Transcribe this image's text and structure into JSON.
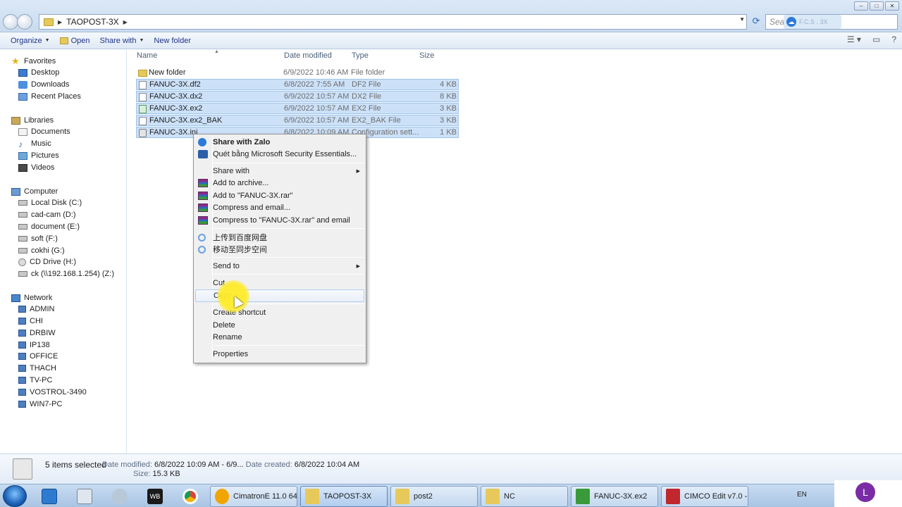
{
  "window": {
    "address": {
      "segments": [
        "TAOPOST-3X"
      ]
    },
    "search_placeholder": "Sea",
    "zalo_overlay": "F.C.S . 3X"
  },
  "toolbar": {
    "organize": "Organize",
    "open": "Open",
    "share_with": "Share with",
    "new_folder": "New folder"
  },
  "nav": {
    "favorites": "Favorites",
    "desktop": "Desktop",
    "downloads": "Downloads",
    "recent_places": "Recent Places",
    "libraries": "Libraries",
    "documents": "Documents",
    "music": "Music",
    "pictures": "Pictures",
    "videos": "Videos",
    "computer": "Computer",
    "drive_c": "Local Disk (C:)",
    "drive_d": "cad-cam (D:)",
    "drive_e": "document (E:)",
    "drive_f": "soft (F:)",
    "drive_g": "cokhi (G:)",
    "drive_h": "CD Drive (H:)",
    "drive_z": "ck (\\\\192.168.1.254) (Z:)",
    "network": "Network",
    "hosts": [
      "ADMIN",
      "CHI",
      "DRBIW",
      "IP138",
      "OFFICE",
      "THACH",
      "TV-PC",
      "VOSTROL-3490",
      "WIN7-PC"
    ]
  },
  "columns": {
    "name": "Name",
    "date": "Date modified",
    "type": "Type",
    "size": "Size"
  },
  "files": [
    {
      "name": "New folder",
      "date": "6/9/2022 10:46 AM",
      "type": "File folder",
      "size": ""
    },
    {
      "name": "FANUC-3X.df2",
      "date": "6/8/2022 7:55 AM",
      "type": "DF2 File",
      "size": "4 KB"
    },
    {
      "name": "FANUC-3X.dx2",
      "date": "6/9/2022 10:57 AM",
      "type": "DX2 File",
      "size": "8 KB"
    },
    {
      "name": "FANUC-3X.ex2",
      "date": "6/9/2022 10:57 AM",
      "type": "EX2 File",
      "size": "3 KB"
    },
    {
      "name": "FANUC-3X.ex2_BAK",
      "date": "6/9/2022 10:57 AM",
      "type": "EX2_BAK File",
      "size": "3 KB"
    },
    {
      "name": "FANUC-3X.ini",
      "date": "6/8/2022 10:09 AM",
      "type": "Configuration sett...",
      "size": "1 KB"
    }
  ],
  "menu": {
    "share_zalo": "Share with Zalo",
    "scan_mse": "Quét bằng Microsoft Security Essentials...",
    "share_with": "Share with",
    "add_archive": "Add to archive...",
    "add_rar": "Add to \"FANUC-3X.rar\"",
    "compress_email": "Compress and email...",
    "compress_rar_email": "Compress to \"FANUC-3X.rar\" and email",
    "baidu_upload": "上传到百度网盘",
    "baidu_sync": "移动至同步空间",
    "send_to": "Send to",
    "cut": "Cut",
    "copy": "Copy",
    "create_shortcut": "Create shortcut",
    "delete": "Delete",
    "rename": "Rename",
    "properties": "Properties"
  },
  "details": {
    "selected": "5 items selected",
    "date_modified_label": "Date modified:",
    "date_modified": "6/8/2022 10:09 AM - 6/9...",
    "date_created_label": "Date created:",
    "date_created": "6/8/2022 10:04 AM",
    "size_label": "Size:",
    "size": "15.3 KB"
  },
  "taskbar": {
    "tasks": [
      "CimatronE 11.0 64...",
      "TAOPOST-3X",
      "post2",
      "NC",
      "FANUC-3X.ex2",
      "CIMCO Edit v7.0 -..."
    ],
    "lang": "EN",
    "avatar": "L"
  }
}
